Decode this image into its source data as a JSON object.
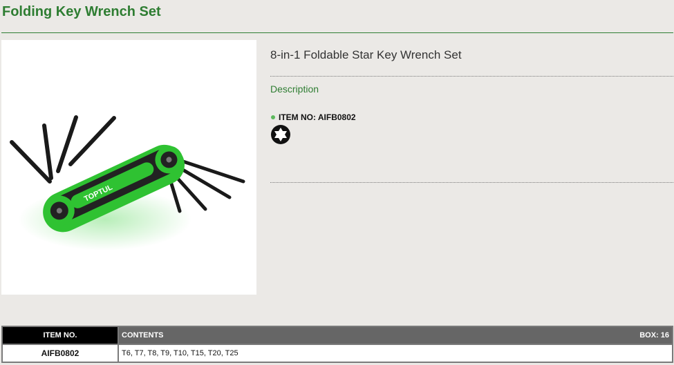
{
  "page": {
    "title": "Folding Key Wrench Set"
  },
  "product": {
    "name": "8-in-1 Foldable Star Key Wrench Set",
    "description_label": "Description",
    "item_no_label": "ITEM NO: AIFB0802",
    "brand_text": "TOPTUL",
    "icon": "torx-star-icon"
  },
  "table": {
    "headers": {
      "item_no": "ITEM NO.",
      "contents": "CONTENTS",
      "box": "BOX: 16"
    },
    "rows": [
      {
        "item_no": "AIFB0802",
        "contents": "T6, T7, T8, T9, T10, T15, T20, T25"
      }
    ]
  },
  "colors": {
    "accent_green": "#2e7d32",
    "tool_green": "#2fc232",
    "background": "#ebe9e6",
    "header_black": "#000000",
    "header_gray": "#666666"
  }
}
